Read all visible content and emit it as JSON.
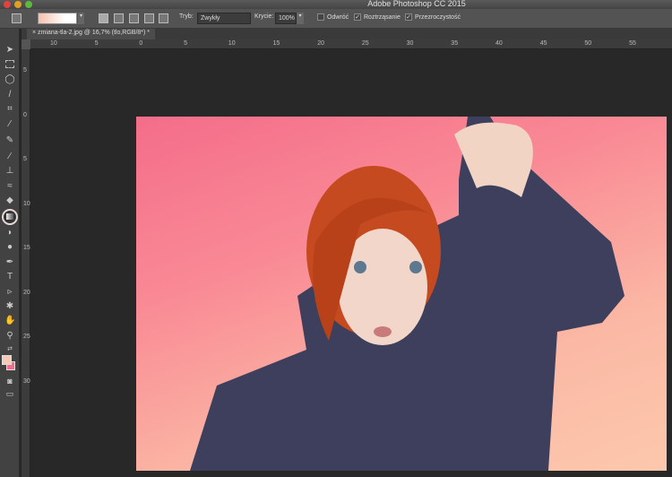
{
  "window": {
    "title": "Adobe Photoshop CC 2015"
  },
  "options": {
    "mode_label": "Tryb:",
    "mode_value": "Zwykły",
    "opacity_label": "Krycie:",
    "opacity_value": "100%",
    "reverse_label": "Odwróć",
    "reverse_checked": false,
    "dither_label": "Roztrząsanie",
    "dither_checked": true,
    "transparency_label": "Przezroczystość",
    "transparency_checked": true
  },
  "document": {
    "tab_label": "zmiana-tla-2.jpg @ 16,7% (tlo,RGB/8*) *"
  },
  "rulers": {
    "horizontal": [
      "10",
      "5",
      "0",
      "5",
      "10",
      "15",
      "20",
      "25",
      "30",
      "35",
      "40",
      "45",
      "50",
      "55"
    ],
    "vertical": [
      "5",
      "0",
      "5",
      "10",
      "15",
      "20",
      "25",
      "30"
    ]
  },
  "toolbar": {
    "active_tool": "gradient-tool",
    "foreground_color": "#f9c9b6",
    "background_color": "#f36e8c"
  },
  "colors": {
    "gradient_start": "#f46d8a",
    "gradient_end": "#fcc8ad"
  }
}
